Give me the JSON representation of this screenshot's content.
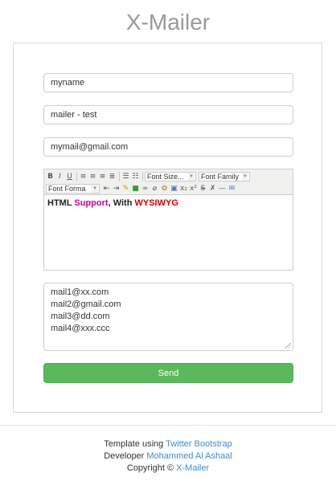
{
  "app": {
    "title": "X-Mailer"
  },
  "form": {
    "name_value": "myname",
    "subject_value": "mailer - test",
    "email_value": "mymail@gmail.com",
    "editor": {
      "toolbar": {
        "font_size_label": "Font Size...",
        "font_family_label": "Font Family",
        "font_format_label": "Font Forma"
      },
      "content": {
        "part1": "HTML ",
        "part2": "Support",
        "part3": ", With ",
        "part4": "WYSIWYG"
      },
      "colors": {
        "support": "#cc0099",
        "wysiwyg": "#cc0000"
      }
    },
    "recipients": [
      "mail1@xx.com",
      "mail2@gmail.com",
      "mail3@dd.com",
      "mail4@xxx.ccc"
    ],
    "send_label": "Send",
    "send_color": "#5cb85c"
  },
  "footer": {
    "line1_text": "Template using ",
    "line1_link": "Twitter Bootstrap",
    "line2_text": "Developer ",
    "line2_link": "Mohammed Al Ashaal",
    "line3_text": "Copyright © ",
    "line3_link": "X-Mailer",
    "link_color": "#428bca"
  }
}
